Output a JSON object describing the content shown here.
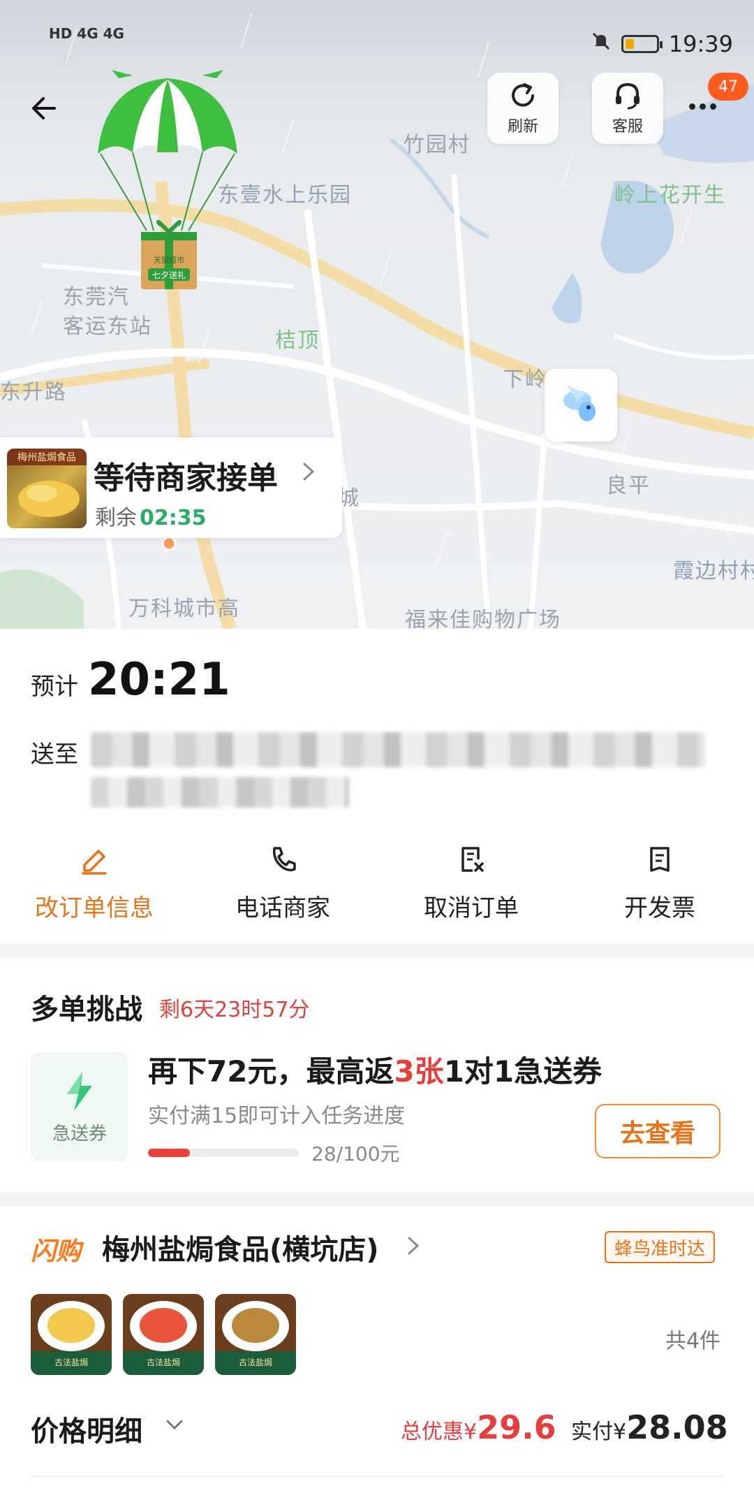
{
  "status_bar": {
    "time": "19:39",
    "network": "HD 4G 4G"
  },
  "map": {
    "labels": [
      "竹园村",
      "东壹水上乐园",
      "岭上花开生",
      "东莞汽",
      "客运东站",
      "桔顶",
      "下岭贝",
      "东升路",
      "良平",
      "城",
      "霞边村村",
      "万科城市高",
      "福来佳购物广场"
    ]
  },
  "top": {
    "refresh_label": "刷新",
    "service_label": "客服",
    "badge_count": "47",
    "parachute_text_1": "天猫超市",
    "parachute_text_2": "七夕送礼"
  },
  "order_status": {
    "title": "等待商家接单",
    "remain_label": "剩余",
    "remain_time": "02:35",
    "thumb_text": "梅州盐焗食品"
  },
  "delivery": {
    "eta_prefix": "预计",
    "eta_time": "20:21",
    "address_prefix": "送至"
  },
  "actions": [
    {
      "label": "改订单信息",
      "icon": "edit-icon"
    },
    {
      "label": "电话商家",
      "icon": "phone-icon"
    },
    {
      "label": "取消订单",
      "icon": "cancel-order-icon"
    },
    {
      "label": "开发票",
      "icon": "invoice-icon"
    }
  ],
  "challenge": {
    "title": "多单挑战",
    "remain": "剩6天23时57分",
    "coupon_label": "急送券",
    "main_prefix": "再下72元，最高返",
    "main_highlight": "3张",
    "main_suffix": "1对1急送券",
    "sub": "实付满15即可计入任务进度",
    "progress_text": "28/100元",
    "progress_fraction": 0.28,
    "button": "去查看"
  },
  "store": {
    "tag": "闪购",
    "name": "梅州盐焗食品(横坑店)",
    "badge": "蜂鸟准时达",
    "items_count": "共4件",
    "item_band": "古法盐焗"
  },
  "price": {
    "title": "价格明细",
    "discount_label": "总优惠",
    "currency": "¥",
    "discount_value": "29.6",
    "paid_label": "实付",
    "paid_value": "28.08"
  },
  "colors": {
    "accent": "#e9731b",
    "red": "#e83d3d",
    "green": "#2aae67"
  }
}
